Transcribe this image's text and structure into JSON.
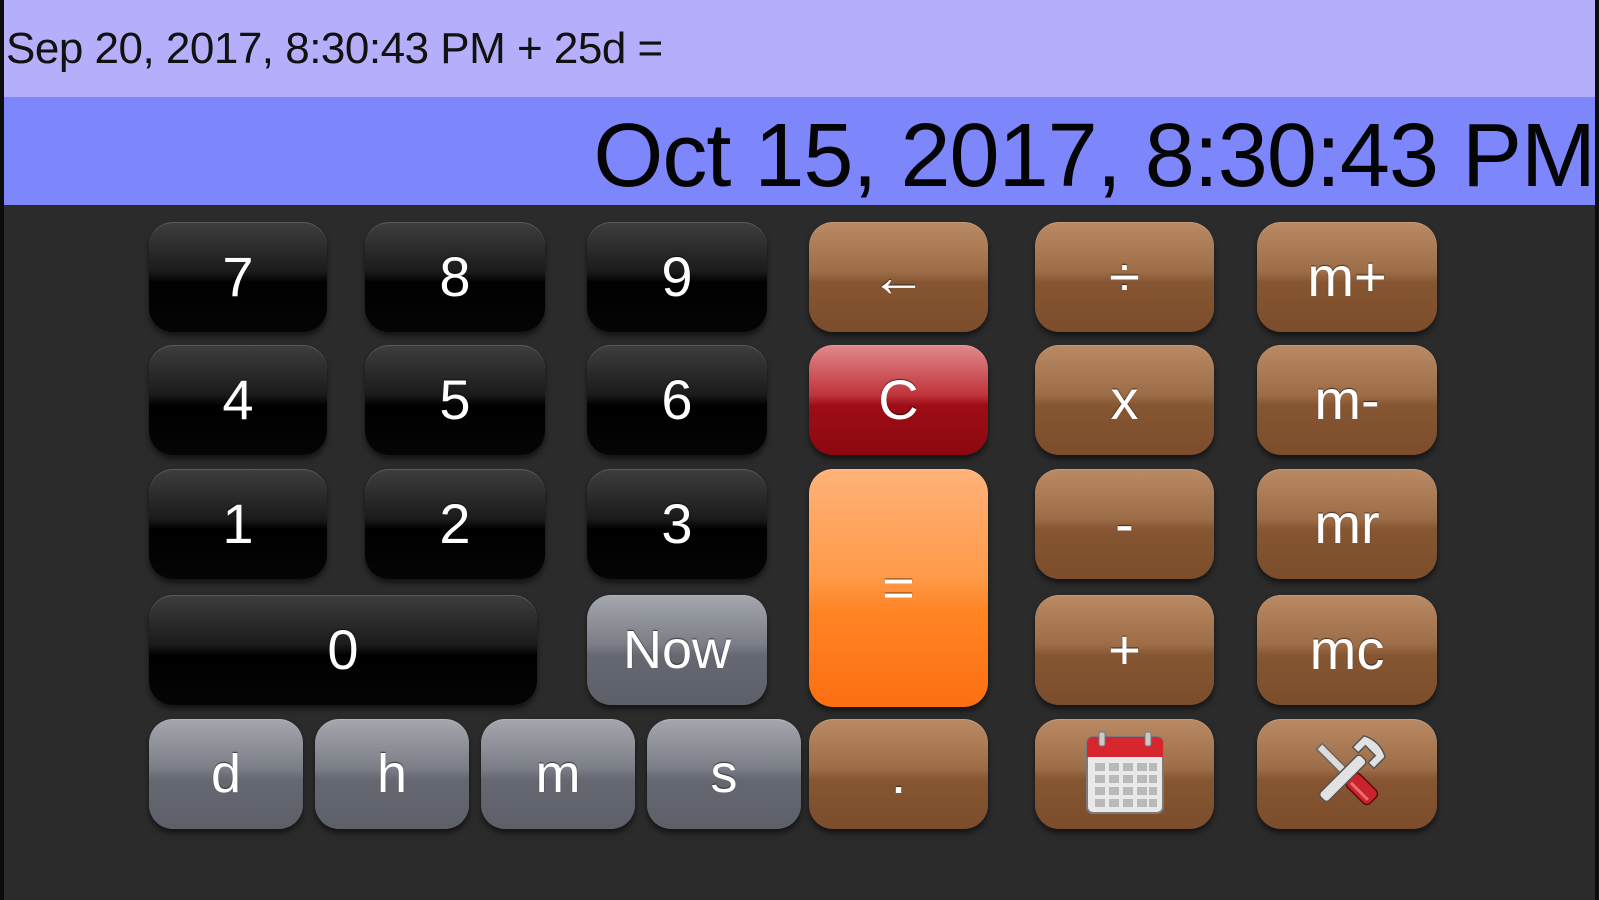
{
  "display": {
    "expression": "Sep 20, 2017, 8:30:43 PM + 25d =",
    "result": "Oct 15, 2017, 8:30:43 PM"
  },
  "keys": {
    "k7": "7",
    "k8": "8",
    "k9": "9",
    "k4": "4",
    "k5": "5",
    "k6": "6",
    "k1": "1",
    "k2": "2",
    "k3": "3",
    "k0": "0",
    "now": "Now",
    "d": "d",
    "h": "h",
    "m": "m",
    "s": "s",
    "backspace": "←",
    "clear": "C",
    "equals": "=",
    "dot": ".",
    "divide": "÷",
    "multiply": "x",
    "minus": "-",
    "plus": "+",
    "m_plus": "m+",
    "m_minus": "m-",
    "mr": "mr",
    "mc": "mc"
  },
  "icons": {
    "calendar": "calendar-icon",
    "settings": "tools-icon"
  },
  "colors": {
    "expression_bg": "#b5aefb",
    "result_bg": "#7d86fb",
    "background": "#2b2b2b",
    "digit_key": "#000000",
    "unit_key": "#6b6e76",
    "function_key": "#8f603b",
    "clear_key": "#a3121a",
    "equals_key": "#ff8a2e"
  }
}
